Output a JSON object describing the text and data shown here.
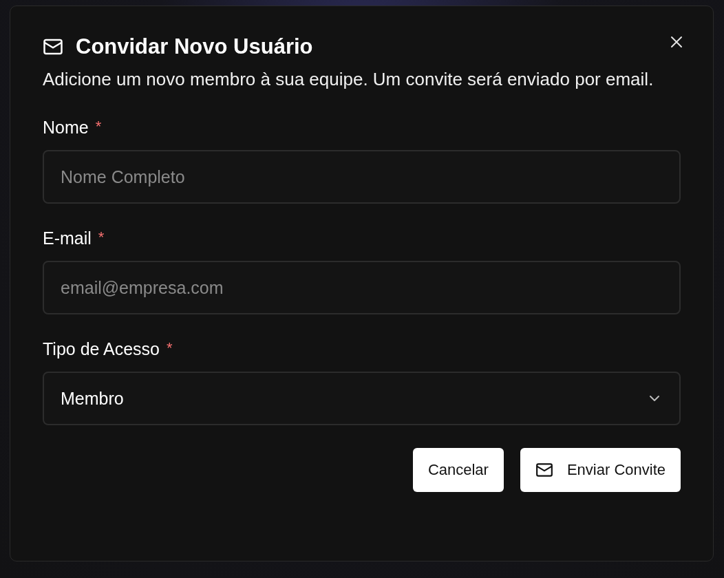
{
  "dialog": {
    "title": "Convidar Novo Usuário",
    "description": "Adicione um novo membro à sua equipe. Um convite será enviado por email."
  },
  "fields": [
    {
      "kind": "input",
      "label": "Nome",
      "required": true,
      "placeholder": "Nome Completo"
    },
    {
      "kind": "input",
      "label": "E-mail",
      "required": true,
      "placeholder": "email@empresa.com"
    },
    {
      "kind": "select",
      "label": "Tipo de Acesso",
      "required": true,
      "value": "Membro"
    }
  ],
  "required_mark": "*",
  "buttons": [
    {
      "kind": "plain",
      "label": "Cancelar"
    },
    {
      "kind": "mail",
      "label": "Enviar Convite"
    }
  ]
}
